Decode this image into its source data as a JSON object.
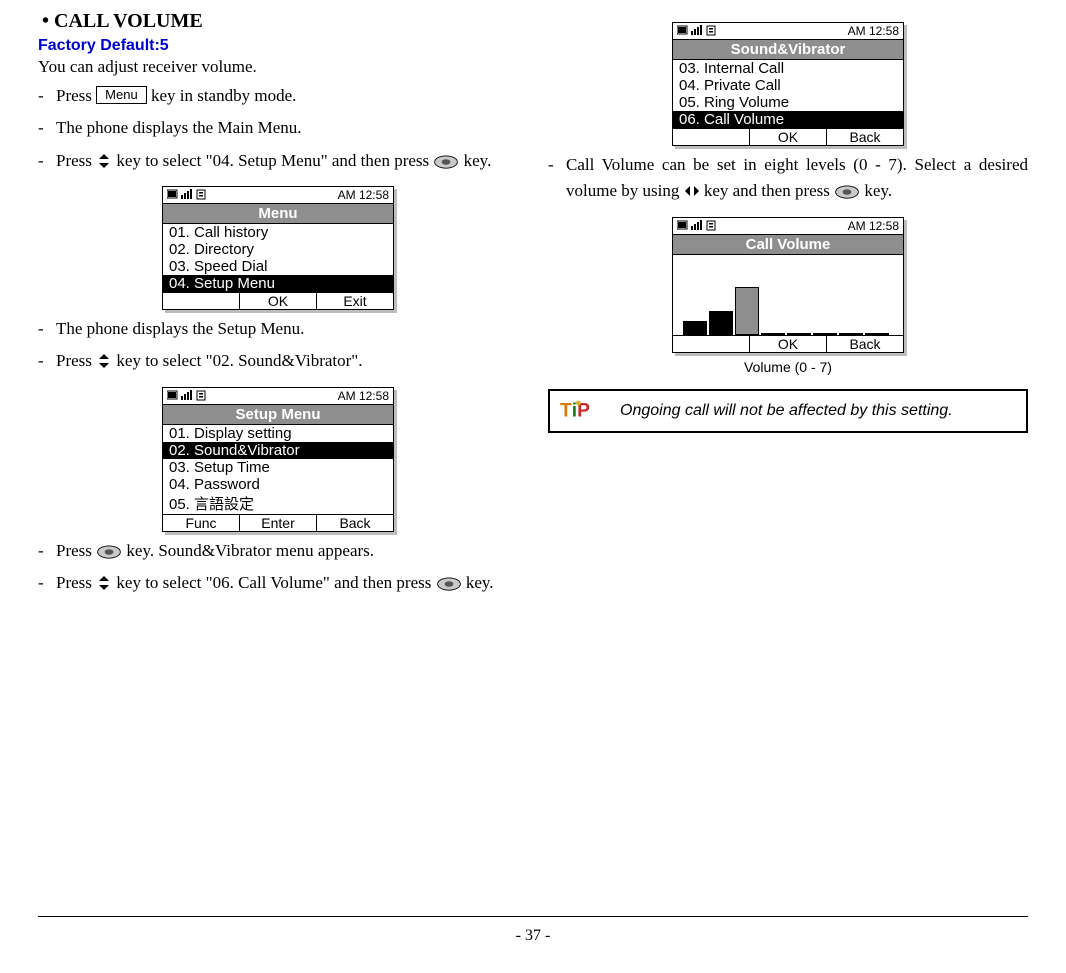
{
  "heading": "CALL VOLUME",
  "factory_default": "Factory Default:5",
  "intro": "You can adjust receiver volume.",
  "menu_key_label": "Menu",
  "steps_left": {
    "s1a": "Press ",
    "s1b": " key in standby mode.",
    "s2": "The phone displays the Main Menu.",
    "s3a": "Press ",
    "s3b": " key to select \"04. Setup Menu\" and then press ",
    "s3c": " key.",
    "s4": "The phone displays the Setup Menu.",
    "s5a": "Press ",
    "s5b": " key to select \"02. Sound&Vibrator\".",
    "s6a": "Press ",
    "s6b": " key. Sound&Vibrator menu appears.",
    "s7a": "Press ",
    "s7b": " key to select \"06. Call Volume\" and then press ",
    "s7c": " key."
  },
  "steps_right": {
    "r1a": "Call Volume can be set in eight levels (0 - 7). Select a desired volume by using ",
    "r1b": " key and then press ",
    "r1c": " key."
  },
  "tip": "Ongoing call will not be affected by this setting.",
  "time": "AM 12:58",
  "screen_menu": {
    "title": "Menu",
    "i1": "01. Call history",
    "i2": "02. Directory",
    "i3": "03. Speed Dial",
    "i4": "04. Setup Menu",
    "soft_mid": "OK",
    "soft_right": "Exit"
  },
  "screen_setup": {
    "title": "Setup Menu",
    "i1": "01. Display setting",
    "i2": "02. Sound&Vibrator",
    "i3": "03. Setup Time",
    "i4": "04. Password",
    "i5": "05. 言語設定",
    "soft_left": "Func",
    "soft_mid": "Enter",
    "soft_right": "Back"
  },
  "screen_sound": {
    "title": "Sound&Vibrator",
    "i1": "03. Internal Call",
    "i2": "04. Private Call",
    "i3": "05. Ring Volume",
    "i4": "06. Call Volume",
    "soft_mid": "OK",
    "soft_right": "Back"
  },
  "screen_vol": {
    "title": "Call Volume",
    "caption": "Volume (0 - 7)",
    "soft_mid": "OK",
    "soft_right": "Back"
  },
  "page_number": "- 37 -"
}
